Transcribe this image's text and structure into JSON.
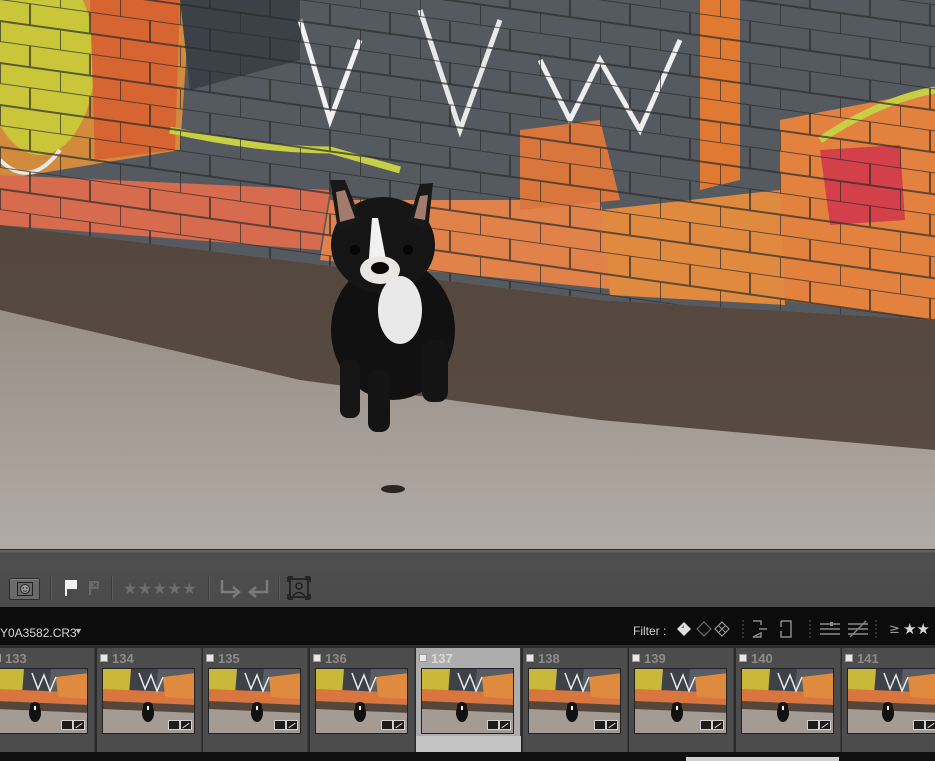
{
  "toolbar": {
    "face_button": "face-region-icon",
    "flag_pick": "pick-flag-icon",
    "flag_reject": "reject-flag-icon",
    "stars": "★★★★★",
    "rotate_ccw": "rotate-left-icon",
    "rotate_cw": "rotate-right-icon",
    "crop": "crop-overlay-icon"
  },
  "filmstrip_header": {
    "filename": "Y0A3582.CR3",
    "filter_label": "Filter :",
    "rating_operator": "≥",
    "filter_stars": "★★"
  },
  "filmstrip": {
    "cells": [
      {
        "number": "133",
        "selected": false,
        "dog_pos": 0.42
      },
      {
        "number": "134",
        "selected": false,
        "dog_pos": 0.48
      },
      {
        "number": "135",
        "selected": false,
        "dog_pos": 0.52
      },
      {
        "number": "136",
        "selected": false,
        "dog_pos": 0.47
      },
      {
        "number": "137",
        "selected": true,
        "dog_pos": 0.43
      },
      {
        "number": "138",
        "selected": false,
        "dog_pos": 0.46
      },
      {
        "number": "139",
        "selected": false,
        "dog_pos": 0.45
      },
      {
        "number": "140",
        "selected": false,
        "dog_pos": 0.44
      },
      {
        "number": "141",
        "selected": false,
        "dog_pos": 0.43
      }
    ]
  },
  "colors": {
    "toolbar_bg": "#4a4a4a",
    "header_bg": "#0c0c0c",
    "cell_bg": "#4c4c4c",
    "cell_selected_bg": "#adadad"
  }
}
